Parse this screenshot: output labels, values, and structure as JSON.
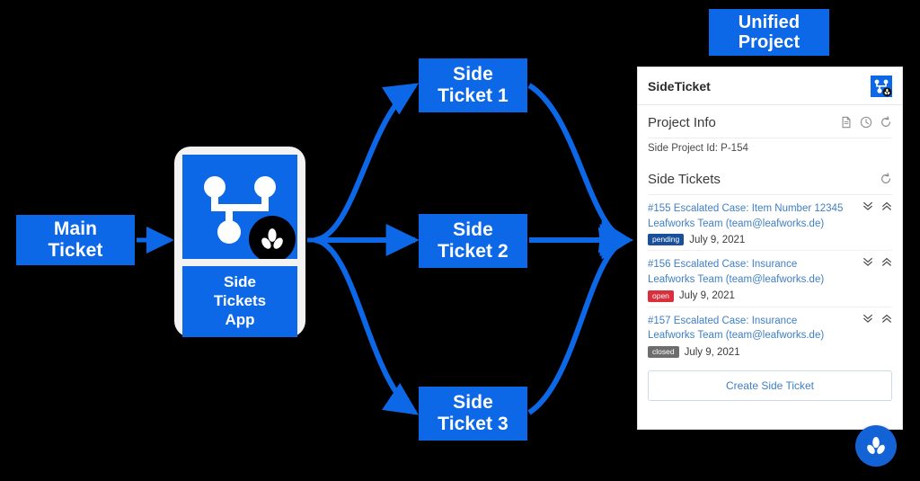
{
  "colors": {
    "accent_blue": "#0d68e8",
    "link_blue": "#3f7fc4",
    "badge_pending": "#1a4f9c",
    "badge_open": "#d9303e",
    "badge_closed": "#6d6d6d",
    "canvas": "#000000",
    "panel_bg": "#ffffff"
  },
  "diagram": {
    "main_ticket": "Main\nTicket",
    "app_card": {
      "label": "Side\nTickets\nApp",
      "icon": "sitemap-icon",
      "badge_icon": "leaf-icon"
    },
    "side_tickets": [
      "Side\nTicket 1",
      "Side\nTicket 2",
      "Side\nTicket 3"
    ],
    "unified_project": "Unified\nProject"
  },
  "panel": {
    "title": "SideTicket",
    "logo_icon": "sitemap-app-icon",
    "project_info": {
      "heading": "Project Info",
      "icons": [
        "document-icon",
        "clock-icon",
        "refresh-icon"
      ],
      "project_id": "Side Project Id: P-154"
    },
    "side_tickets_section": {
      "heading": "Side Tickets",
      "icons": [
        "refresh-icon"
      ],
      "tickets": [
        {
          "title": "#155 Escalated Case: Item Number 12345",
          "team": "Leafworks Team (team@leafworks.de)",
          "status": "pending",
          "date": "July 9, 2021",
          "actions": [
            "chevron-double-down-icon",
            "chevron-double-up-icon"
          ]
        },
        {
          "title": "#156 Escalated Case: Insurance",
          "team": "Leafworks Team (team@leafworks.de)",
          "status": "open",
          "date": "July 9, 2021",
          "actions": [
            "chevron-double-down-icon",
            "chevron-double-up-icon"
          ]
        },
        {
          "title": "#157 Escalated Case: Insurance",
          "team": "Leafworks Team (team@leafworks.de)",
          "status": "closed",
          "date": "July 9, 2021",
          "actions": [
            "chevron-double-down-icon",
            "chevron-double-up-icon"
          ]
        }
      ]
    },
    "create_button": "Create Side Ticket"
  },
  "fab": {
    "icon": "leaf-icon"
  }
}
